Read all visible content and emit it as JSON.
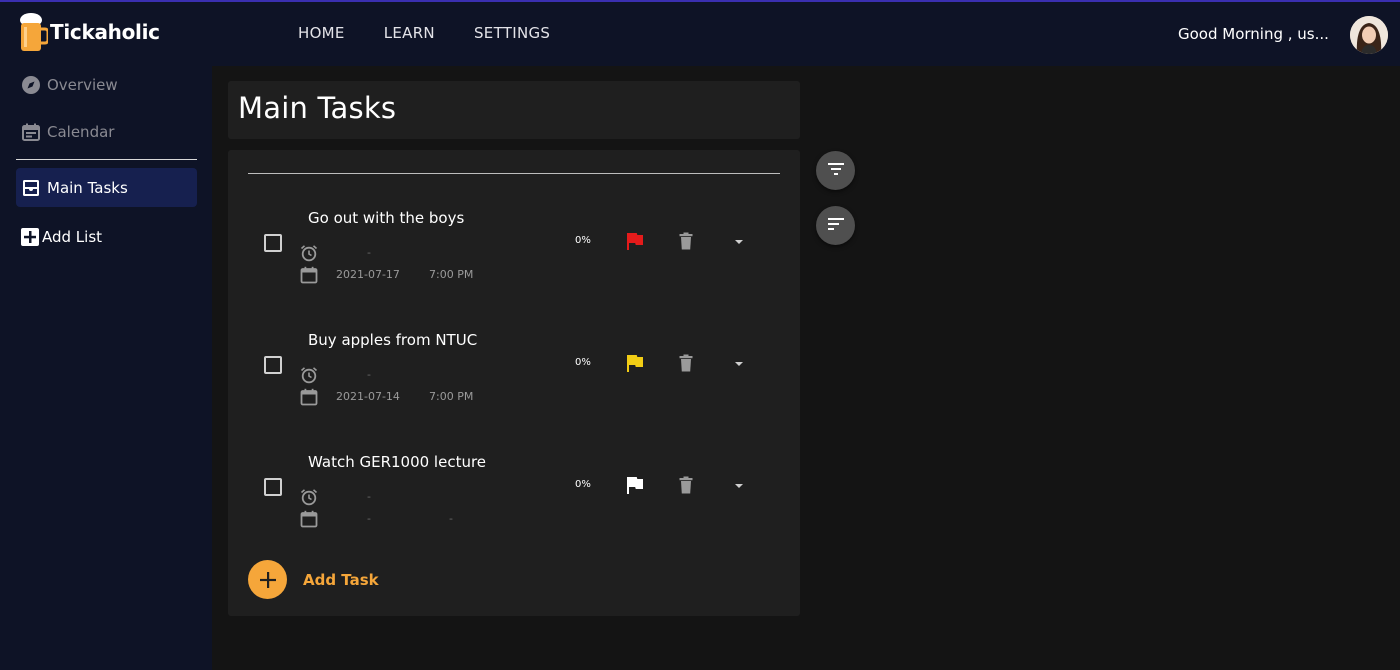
{
  "app": {
    "logo_text": "Tickaholic"
  },
  "nav": {
    "items": [
      "HOME",
      "LEARN",
      "SETTINGS"
    ]
  },
  "header": {
    "greeting": "Good Morning , us..."
  },
  "sidebar": {
    "items": [
      {
        "label": "Overview",
        "icon": "compass-icon"
      },
      {
        "label": "Calendar",
        "icon": "calendar-icon"
      },
      {
        "label": "Main Tasks",
        "icon": "inbox-icon"
      },
      {
        "label": "Add List",
        "icon": "add-box-icon"
      }
    ]
  },
  "main": {
    "title": "Main Tasks",
    "tasks": [
      {
        "name": "Go out with the boys",
        "reminder": "-",
        "date": "2021-07-17",
        "time": "7:00 PM",
        "progress": "0%",
        "flag_color": "#e51b1b"
      },
      {
        "name": "Buy apples from NTUC",
        "reminder": "-",
        "date": "2021-07-14",
        "time": "7:00 PM",
        "progress": "0%",
        "flag_color": "#f2cd15"
      },
      {
        "name": "Watch GER1000 lecture",
        "reminder": "-",
        "date": "-",
        "time": "-",
        "progress": "0%",
        "flag_color": "#ffffff"
      }
    ],
    "add_task_label": "Add Task"
  },
  "colors": {
    "accent": "#f5a63a",
    "sidebar_bg": "#0e1326",
    "active_bg": "#16204f"
  }
}
